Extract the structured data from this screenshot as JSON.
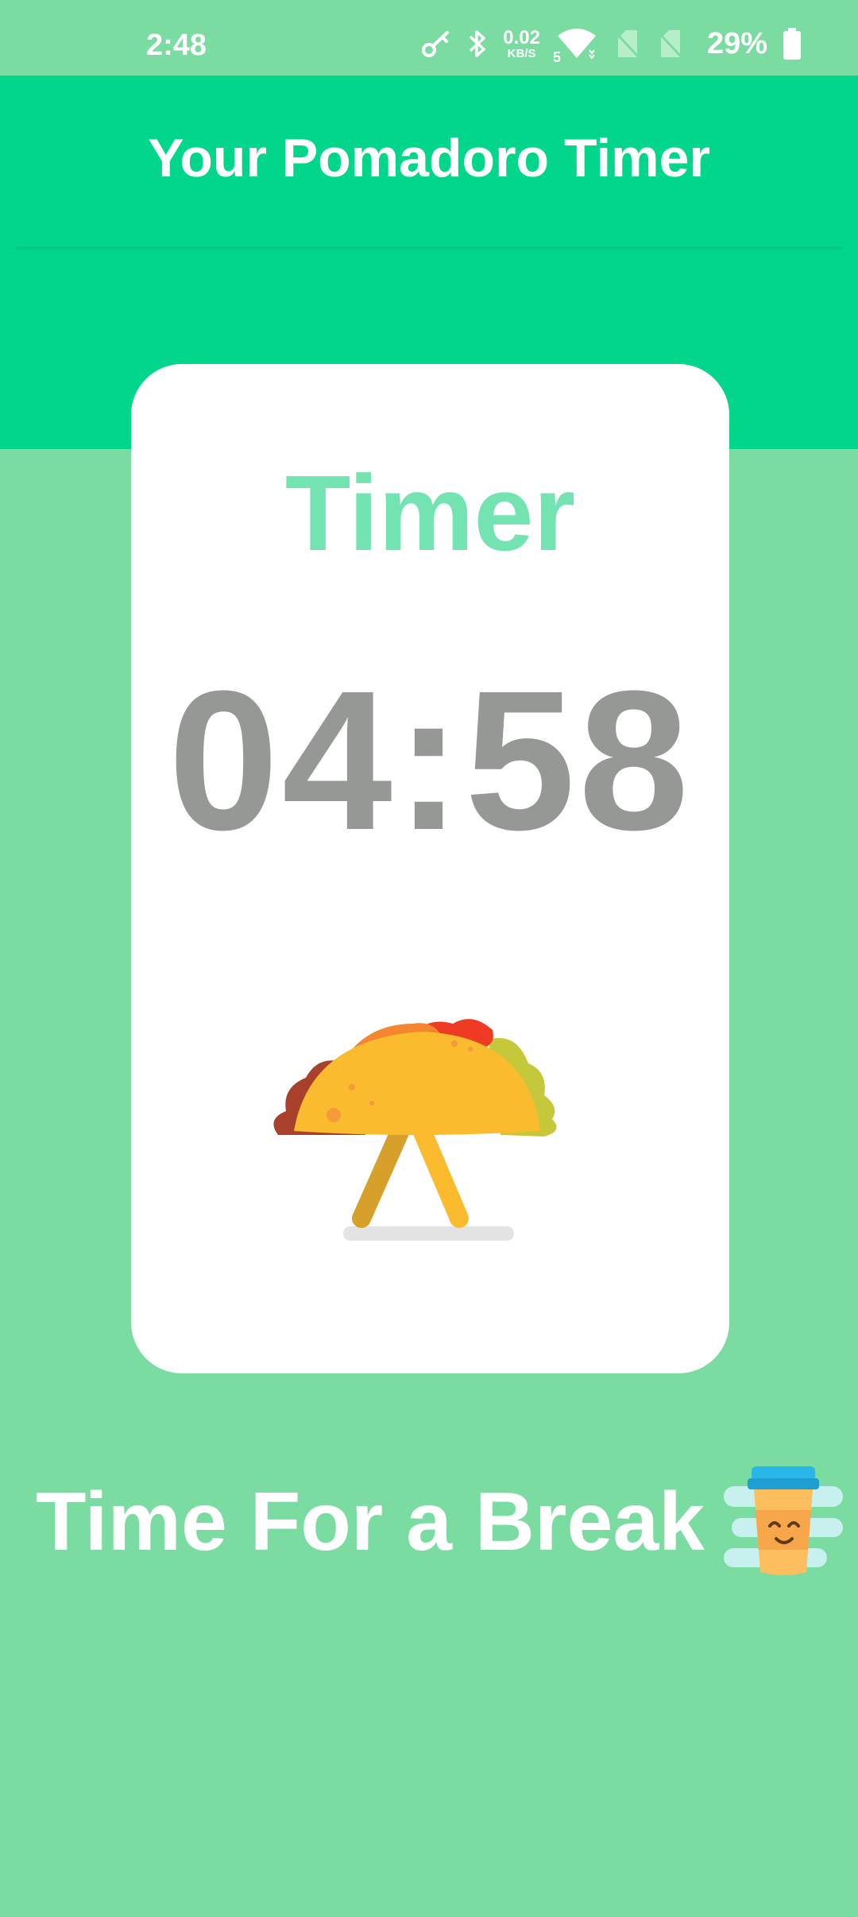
{
  "status_bar": {
    "time": "2:48",
    "net_speed_value": "0.02",
    "net_speed_unit": "KB/S",
    "signal_label": "5",
    "battery": "29%"
  },
  "app": {
    "title": "Your Pomadoro Timer"
  },
  "timer_card": {
    "title": "Timer",
    "time_remaining": "04:58",
    "illustration": "taco-illustration"
  },
  "break_message": {
    "text": "Time For a Break",
    "icon": "coffee-cup-icon"
  },
  "colors": {
    "background": "#7bdca2",
    "app_bar": "#02d68a",
    "card_title": "#73e3b1",
    "timer_text": "#959895"
  }
}
